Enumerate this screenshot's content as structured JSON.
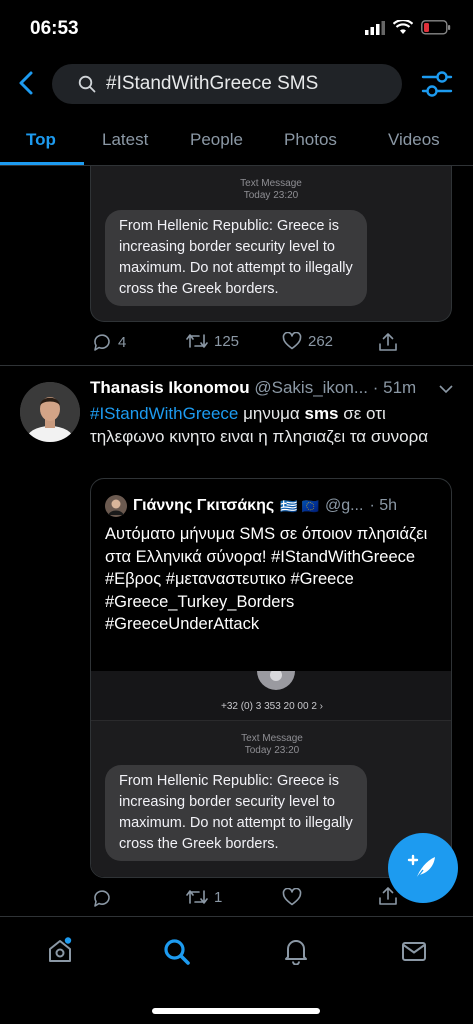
{
  "status": {
    "time": "06:53"
  },
  "search": {
    "query": "#IStandWithGreece SMS"
  },
  "tabs": [
    {
      "label": "Top"
    },
    {
      "label": "Latest"
    },
    {
      "label": "People"
    },
    {
      "label": "Photos"
    },
    {
      "label": "Videos"
    }
  ],
  "prev_tweet": {
    "sms_meta_1": "Text Message",
    "sms_meta_2": "Today 23:20",
    "sms_text": "From Hellenic Republic: Greece is increasing border security level to maximum. Do not attempt to illegally cross the Greek borders.",
    "replies": "4",
    "retweets": "125",
    "likes": "262"
  },
  "tweet": {
    "name": "Thanasis Ikonomou",
    "handle": "@Sakis_ikon...",
    "time": "· 51m",
    "hashtag": "#IStandWithGreece",
    "text_1": " μηνυμα ",
    "text_bold": "sms",
    "text_2": " σε οτι τηλεφωνο κινητο ειναι η πλησιαζει τα συνορα",
    "quote": {
      "name": "Γιάννης Γκιτσάκης",
      "flags": "🇬🇷 🇪🇺",
      "handle": "@g...",
      "time": "· 5h",
      "text": "Αυτόματο μήνυμα SMS σε όποιον πλησιάζει στα Ελληνικά σύνορα! #IStandWithGreece #Εβρος #μεταναστευτικο #Greece #Greece_Turkey_Borders #GreeceUnderAttack",
      "phone": "+32 (0) 3 353 20 00 2",
      "sms_meta_1": "Text Message",
      "sms_meta_2": "Today 23:20",
      "sms_text": "From Hellenic Republic: Greece is increasing border security level to maximum. Do not attempt to illegally cross the Greek borders."
    },
    "replies": "",
    "retweets": "1",
    "likes": ""
  },
  "colors": {
    "accent": "#1d9bf0",
    "background": "#000000"
  },
  "icons": [
    "back-arrow-icon",
    "search-icon",
    "filter-icon",
    "reply-icon",
    "retweet-icon",
    "like-icon",
    "share-icon",
    "compose-icon",
    "home-icon",
    "notifications-icon",
    "messages-icon"
  ]
}
